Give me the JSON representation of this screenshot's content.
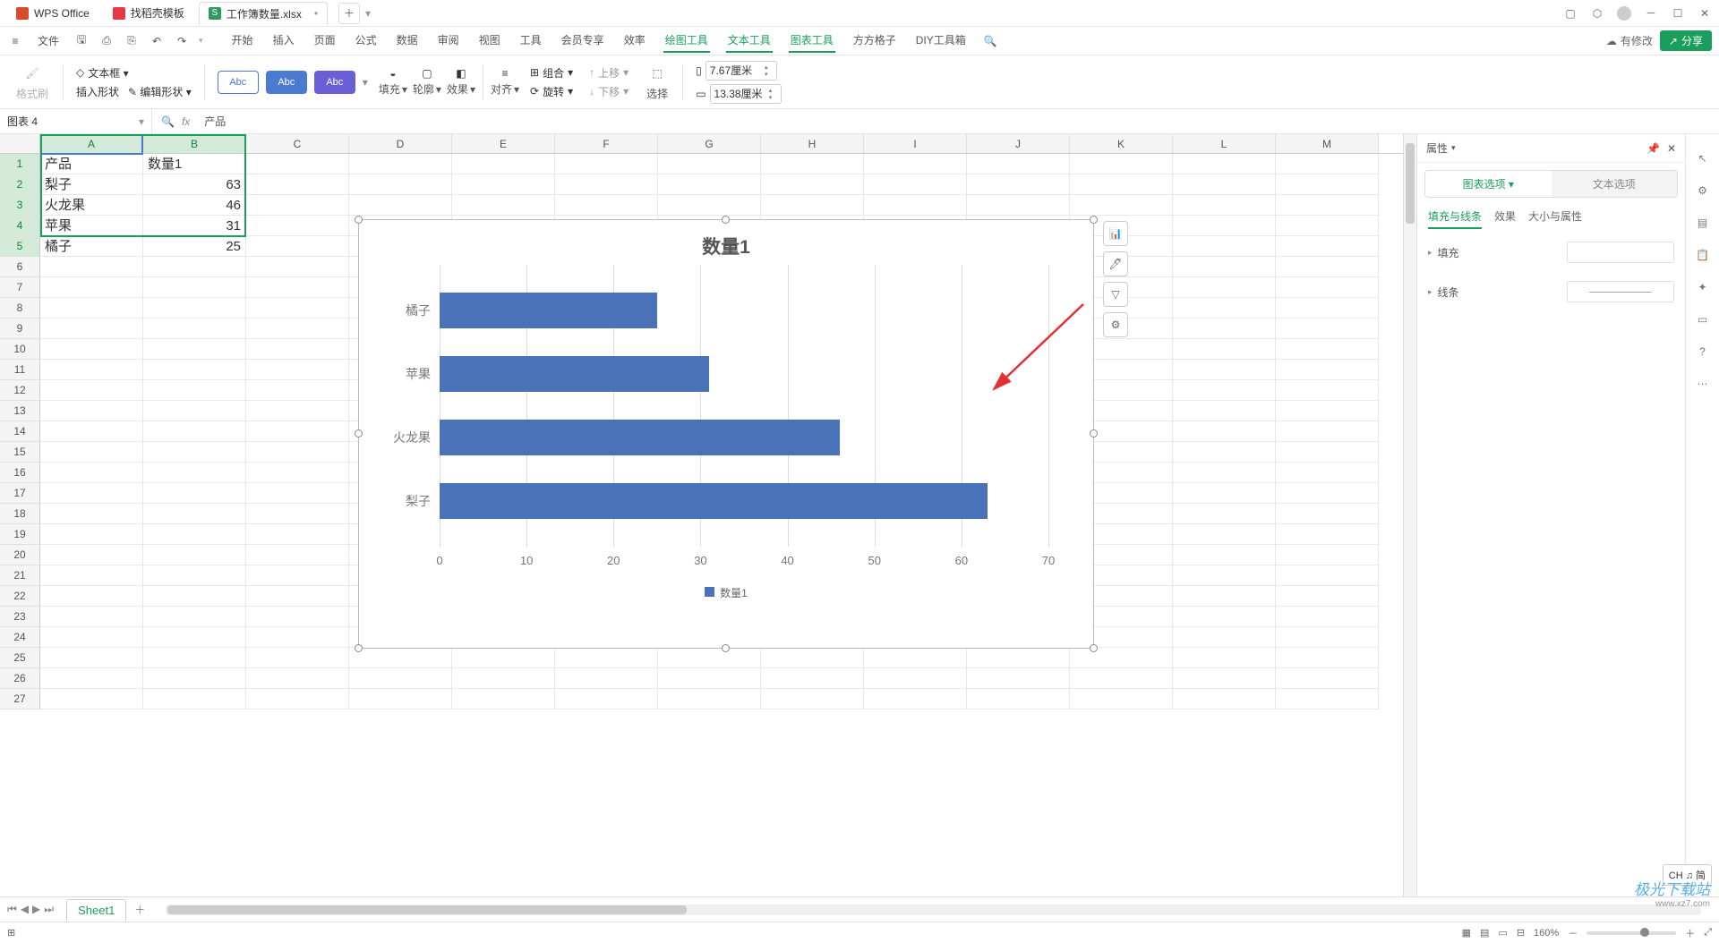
{
  "titlebar": {
    "app": "WPS Office",
    "tab2": "找稻壳模板",
    "tab3": "工作簿数量.xlsx"
  },
  "file_menu": "文件",
  "menubar": [
    "开始",
    "插入",
    "页面",
    "公式",
    "数据",
    "审阅",
    "视图",
    "工具",
    "会员专享",
    "效率",
    "绘图工具",
    "文本工具",
    "图表工具",
    "方方格子",
    "DIY工具箱"
  ],
  "menubar_green_indices": [
    10,
    11,
    12
  ],
  "modify_badge": "有修改",
  "share": "分享",
  "ribbon": {
    "fmt_brush": "格式刷",
    "insert_shape": "插入形状",
    "text_box": "文本框",
    "edit_shape": "编辑形状",
    "abc": "Abc",
    "fill": "填充",
    "outline": "轮廓",
    "effect": "效果",
    "align": "对齐",
    "group": "组合",
    "rotate": "旋转",
    "up": "上移",
    "down": "下移",
    "select": "选择",
    "dim1": "7.67厘米",
    "dim2": "13.38厘米"
  },
  "namebox": "图表 4",
  "formula": "产品",
  "columns": [
    "A",
    "B",
    "C",
    "D",
    "E",
    "F",
    "G",
    "H",
    "I",
    "J",
    "K",
    "L",
    "M"
  ],
  "rownums": [
    "1",
    "2",
    "3",
    "4",
    "5",
    "6",
    "7",
    "8",
    "9",
    "10",
    "11",
    "12",
    "13",
    "14",
    "15",
    "16",
    "17",
    "18",
    "19",
    "20",
    "21",
    "22",
    "23",
    "24",
    "25",
    "26",
    "27"
  ],
  "cells": {
    "A1": "产品",
    "B1": "数量1",
    "A2": "梨子",
    "B2": "63",
    "A3": "火龙果",
    "B3": "46",
    "A4": "苹果",
    "B4": "31",
    "A5": "橘子",
    "B5": "25"
  },
  "chart_data": {
    "type": "bar",
    "orientation": "horizontal",
    "title": "数量1",
    "categories": [
      "橘子",
      "苹果",
      "火龙果",
      "梨子"
    ],
    "values": [
      25,
      31,
      46,
      63
    ],
    "xticks": [
      0,
      10,
      20,
      30,
      40,
      50,
      60,
      70
    ],
    "xlim": [
      0,
      70
    ],
    "legend": "数量1",
    "color": "#4a72b8"
  },
  "right_panel": {
    "title": "属性",
    "tab1": "图表选项",
    "tab2": "文本选项",
    "sub1": "填充与线条",
    "sub2": "效果",
    "sub3": "大小与属性",
    "prop_fill": "填充",
    "prop_line": "线条"
  },
  "sheet_tab": "Sheet1",
  "status": {
    "zoom": "160%",
    "ime": "CH ♫ 简"
  },
  "watermark": {
    "t": "极光下载站",
    "u": "www.xz7.com"
  }
}
